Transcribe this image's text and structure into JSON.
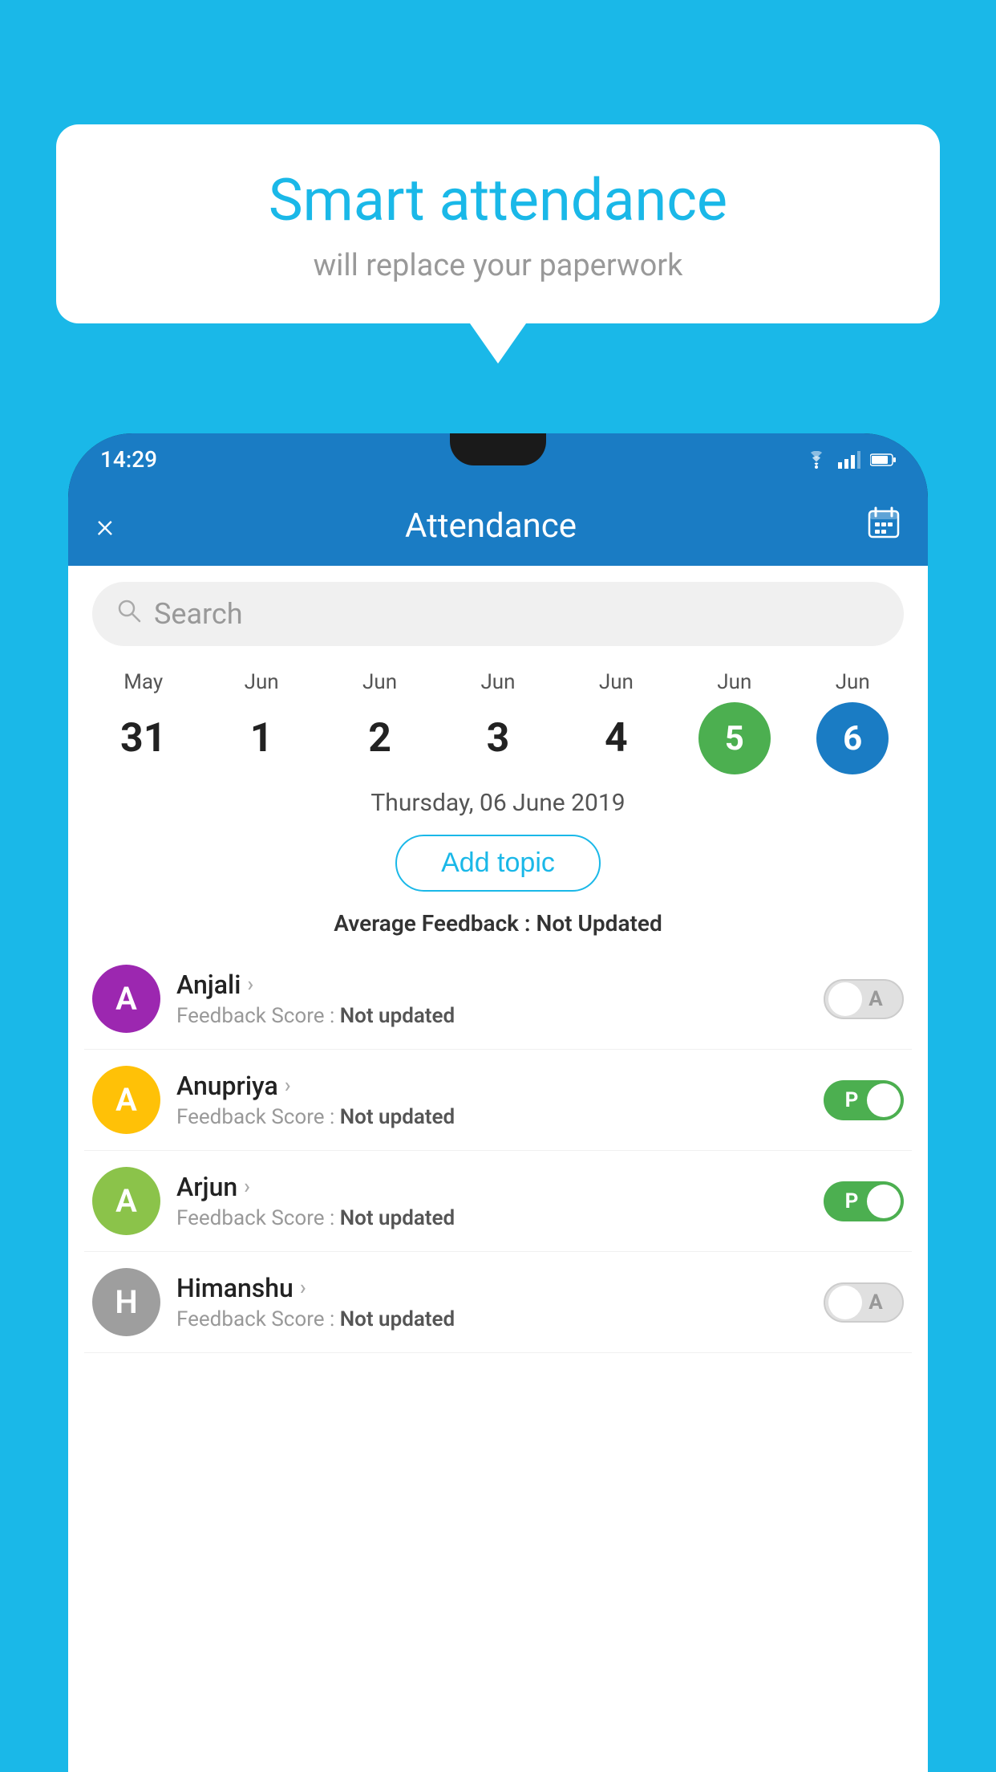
{
  "background_color": "#1ab8e8",
  "speech_bubble": {
    "title": "Smart attendance",
    "subtitle": "will replace your paperwork"
  },
  "status_bar": {
    "time": "14:29",
    "icons": [
      "wifi",
      "signal",
      "battery"
    ]
  },
  "app_header": {
    "title": "Attendance",
    "close_label": "×",
    "calendar_icon": "📅"
  },
  "search": {
    "placeholder": "Search"
  },
  "calendar": {
    "days": [
      {
        "month": "May",
        "date": "31",
        "state": "normal"
      },
      {
        "month": "Jun",
        "date": "1",
        "state": "normal"
      },
      {
        "month": "Jun",
        "date": "2",
        "state": "normal"
      },
      {
        "month": "Jun",
        "date": "3",
        "state": "normal"
      },
      {
        "month": "Jun",
        "date": "4",
        "state": "normal"
      },
      {
        "month": "Jun",
        "date": "5",
        "state": "today"
      },
      {
        "month": "Jun",
        "date": "6",
        "state": "selected"
      }
    ]
  },
  "selected_date_label": "Thursday, 06 June 2019",
  "add_topic_label": "Add topic",
  "average_feedback": {
    "label": "Average Feedback : ",
    "value": "Not Updated"
  },
  "students": [
    {
      "name": "Anjali",
      "avatar_letter": "A",
      "avatar_color": "#9c27b0",
      "feedback_label": "Feedback Score : ",
      "feedback_value": "Not updated",
      "attendance": "absent",
      "toggle_label": "A"
    },
    {
      "name": "Anupriya",
      "avatar_letter": "A",
      "avatar_color": "#ffc107",
      "feedback_label": "Feedback Score : ",
      "feedback_value": "Not updated",
      "attendance": "present",
      "toggle_label": "P"
    },
    {
      "name": "Arjun",
      "avatar_letter": "A",
      "avatar_color": "#8bc34a",
      "feedback_label": "Feedback Score : ",
      "feedback_value": "Not updated",
      "attendance": "present",
      "toggle_label": "P"
    },
    {
      "name": "Himanshu",
      "avatar_letter": "H",
      "avatar_color": "#9e9e9e",
      "feedback_label": "Feedback Score : ",
      "feedback_value": "Not updated",
      "attendance": "absent",
      "toggle_label": "A"
    }
  ]
}
